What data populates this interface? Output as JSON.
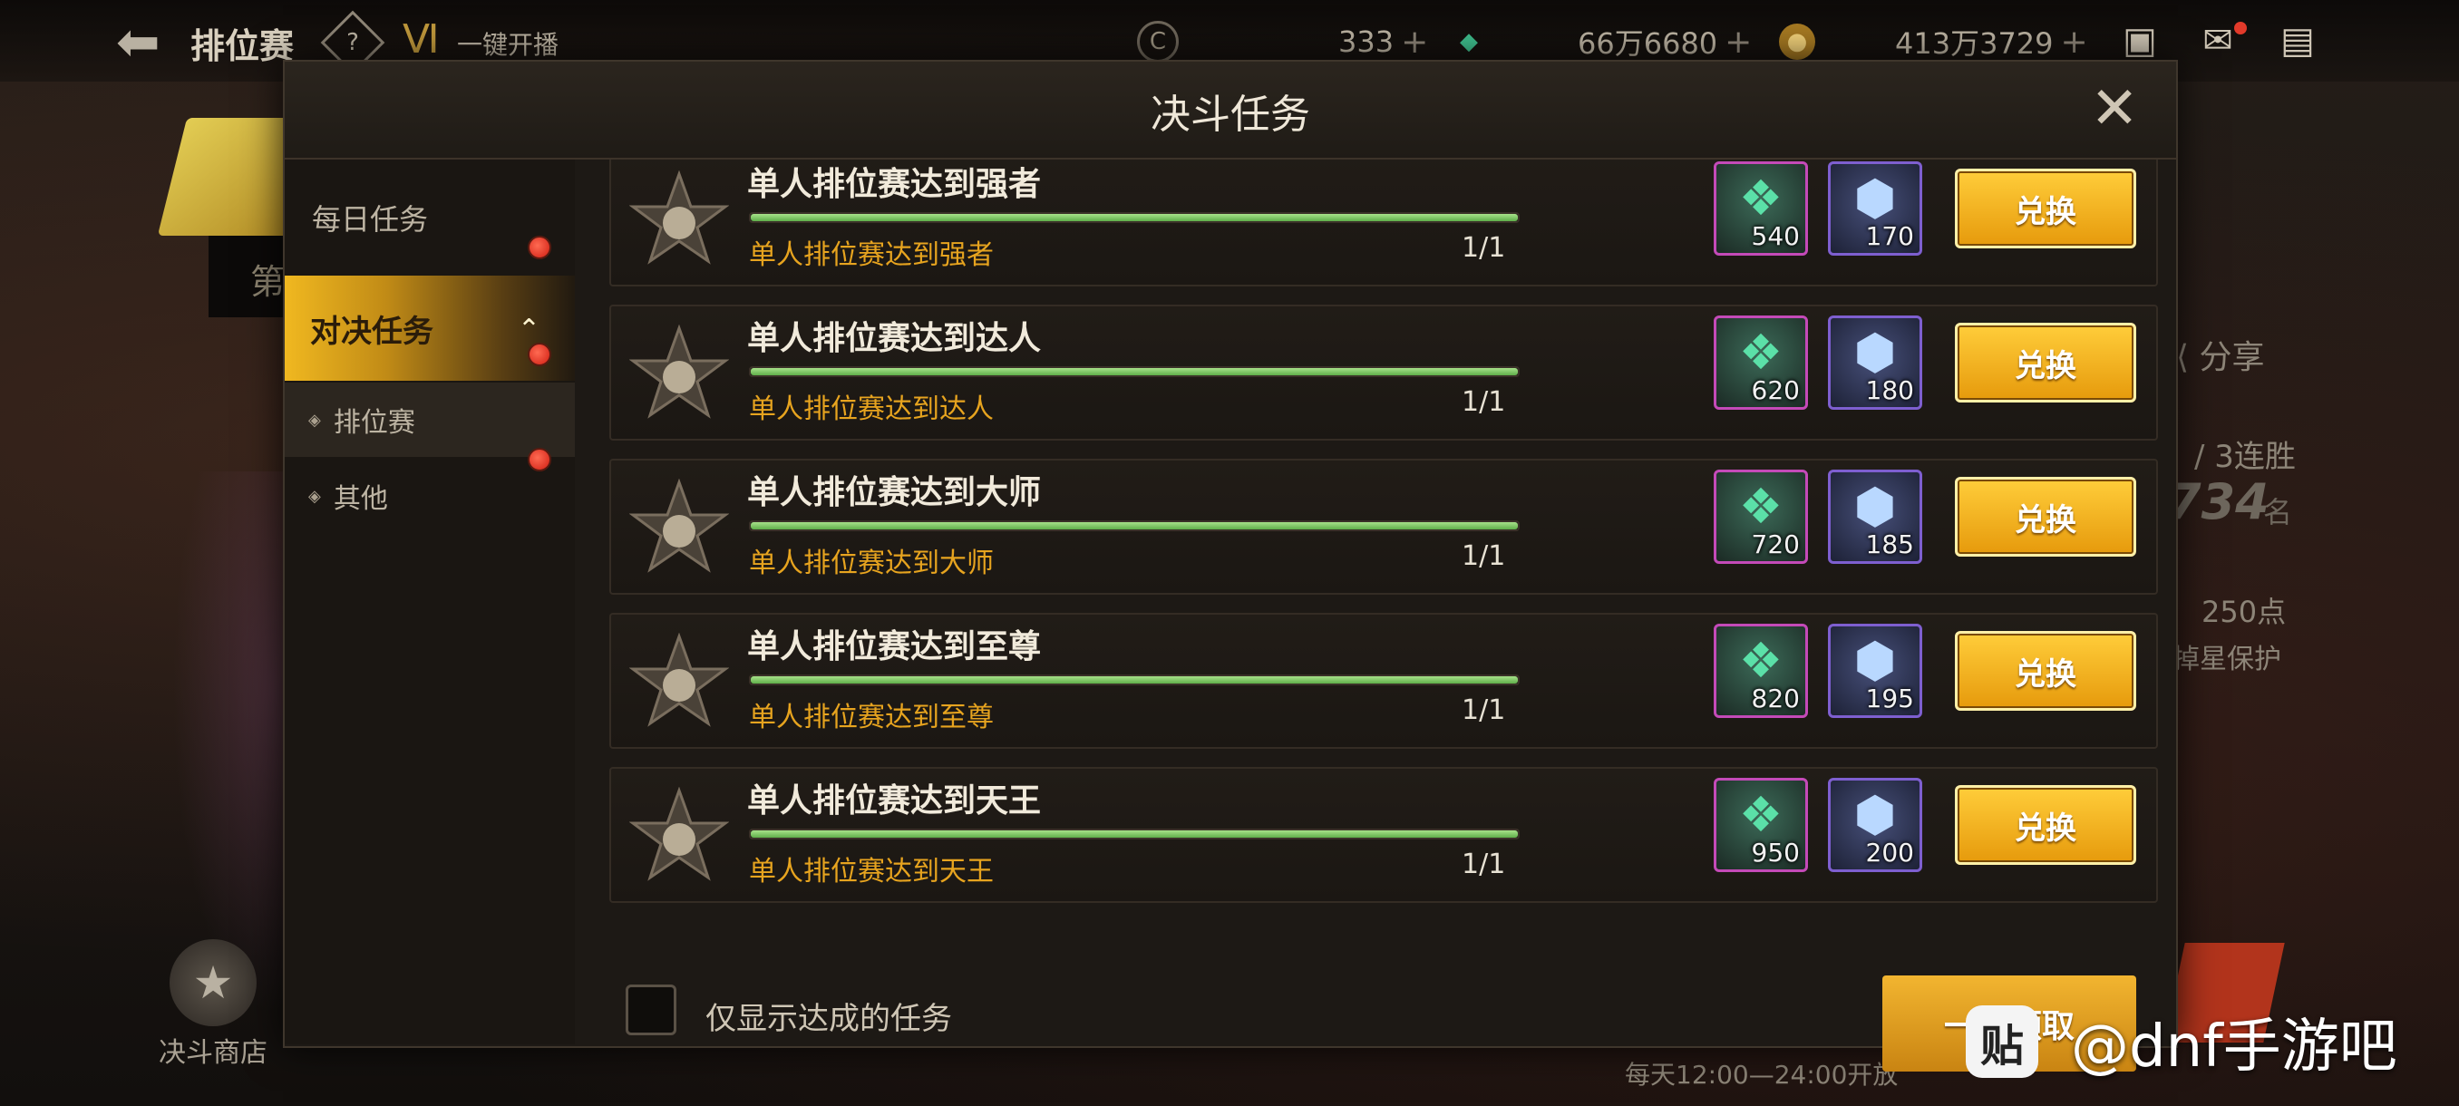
{
  "topbar": {
    "title": "排位赛",
    "help_glyph": "?",
    "live_label": "一键开播",
    "currencies": [
      {
        "icon": "coin-icon",
        "value": "333"
      },
      {
        "icon": "gem-icon",
        "value": "66万6680"
      },
      {
        "icon": "gold-icon",
        "value": "413万3729"
      }
    ],
    "plus_glyph": "+"
  },
  "modal": {
    "title": "决斗任务",
    "close_glyph": "✕"
  },
  "sidebar": {
    "daily": "每日任务",
    "duel": "对决任务",
    "ranked": "排位赛",
    "other": "其他"
  },
  "tasks": [
    {
      "title": "单人排位赛达到强者",
      "sub": "单人排位赛达到强者",
      "count": "1/1",
      "progress": 1.0,
      "reward1": "540",
      "reward2": "170",
      "button": "兑换"
    },
    {
      "title": "单人排位赛达到达人",
      "sub": "单人排位赛达到达人",
      "count": "1/1",
      "progress": 1.0,
      "reward1": "620",
      "reward2": "180",
      "button": "兑换"
    },
    {
      "title": "单人排位赛达到大师",
      "sub": "单人排位赛达到大师",
      "count": "1/1",
      "progress": 1.0,
      "reward1": "720",
      "reward2": "185",
      "button": "兑换"
    },
    {
      "title": "单人排位赛达到至尊",
      "sub": "单人排位赛达到至尊",
      "count": "1/1",
      "progress": 1.0,
      "reward1": "820",
      "reward2": "195",
      "button": "兑换"
    },
    {
      "title": "单人排位赛达到天王",
      "sub": "单人排位赛达到天王",
      "count": "1/1",
      "progress": 1.0,
      "reward1": "950",
      "reward2": "200",
      "button": "兑换"
    }
  ],
  "footer": {
    "checkbox_label": "仅显示达成的任务",
    "claim_all": "一键领取"
  },
  "background": {
    "sub_char": "第",
    "share": "分享",
    "streak": "/ 3连胜",
    "rank_num": "734",
    "rank_unit": "名",
    "points": "250点",
    "protect": "掉星保护",
    "open_time": "每天12:00—24:00开放",
    "shop": "决斗商店"
  },
  "watermark": {
    "icon_text": "贴",
    "text": "@dnf手游吧"
  },
  "colors": {
    "accent_gold": "#e69a0c",
    "progress_green": "#5fae4a",
    "subtitle_orange": "#e7a41f",
    "red_dot": "#d01e12"
  }
}
